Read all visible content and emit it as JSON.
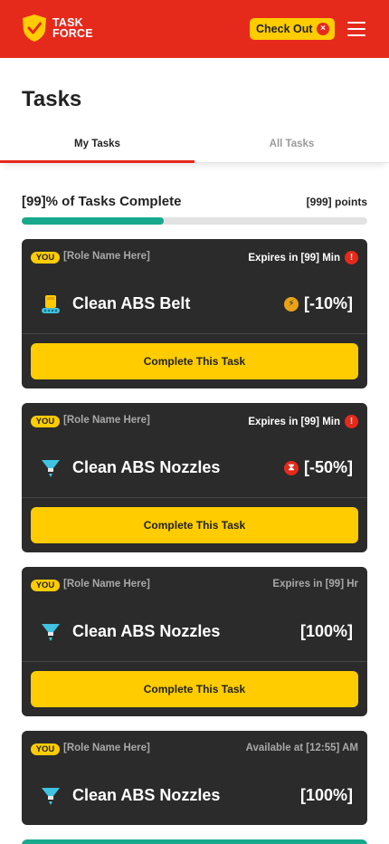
{
  "header": {
    "logo_line1": "TASK",
    "logo_line2": "FORCE",
    "checkout_label": "Check Out",
    "menu_icon": "hamburger-menu-icon"
  },
  "page": {
    "title": "Tasks"
  },
  "tabs": [
    {
      "label": "My Tasks",
      "active": true
    },
    {
      "label": "All Tasks",
      "active": false
    }
  ],
  "progress": {
    "label": "[99]% of Tasks Complete",
    "points": "[999] points",
    "fraction_complete": 0.41
  },
  "tasks": [
    {
      "you": "YOU",
      "role": "[Role Name Here]",
      "timing": "Expires in [99] Min",
      "timing_alert": true,
      "icon": "belt-icon",
      "name": "Clean ABS Belt",
      "value_icon": "bolt-icon",
      "value": "[-10%]",
      "button": "Complete This Task"
    },
    {
      "you": "YOU",
      "role": "[Role Name Here]",
      "timing": "Expires in [99] Min",
      "timing_alert": true,
      "icon": "nozzle-icon",
      "name": "Clean ABS Nozzles",
      "value_icon": "hourglass-icon",
      "value": "[-50%]",
      "button": "Complete This Task"
    },
    {
      "you": "YOU",
      "role": "[Role Name Here]",
      "timing": "Expires in [99] Hr",
      "timing_alert": false,
      "icon": "nozzle-icon",
      "name": "Clean ABS Nozzles",
      "value": "[100%]",
      "button": "Complete This Task"
    },
    {
      "you": "YOU",
      "role": "[Role Name Here]",
      "timing": "Available at [12:55] AM",
      "timing_alert": false,
      "icon": "nozzle-icon",
      "name": "Clean ABS Nozzles",
      "value": "[100%]"
    }
  ],
  "colors": {
    "brand_red": "#e52a1c",
    "accent_yellow": "#ffcc00",
    "progress_green": "#17a98c",
    "card_dark": "#2b2b2b"
  }
}
